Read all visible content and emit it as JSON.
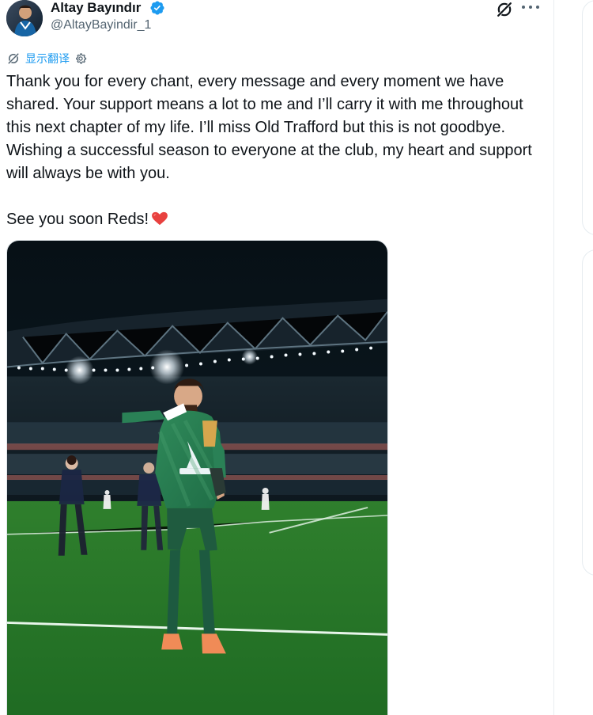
{
  "author": {
    "name": "Altay Bayındır",
    "handle": "@AltayBayindir_1",
    "verified": true,
    "verified_color": "#1d9bf0"
  },
  "actions": {
    "grok_icon": "grok-icon",
    "more_icon": "more-dots-icon"
  },
  "translate": {
    "icon": "grok-icon",
    "label": "显示翻译",
    "settings_icon": "gear-icon"
  },
  "tweet": {
    "paragraph_1": "Thank you for every chant, every message and every moment we have shared. Your support means a lot to me and I’ll carry it with me throughout this next chapter of my life. I’ll miss Old Trafford but this is not goodbye. Wishing a successful season to everyone at the club, my heart and support will always be with you.",
    "paragraph_2": "See you soon Reds!",
    "emoji": "red-heart-emoji"
  },
  "media": {
    "type": "photo",
    "description_icon": "goalkeeper-photo"
  },
  "colors": {
    "text": "#0f1419",
    "secondary": "#536471",
    "accent": "#1d9bf0",
    "heart": "#e8413f"
  }
}
